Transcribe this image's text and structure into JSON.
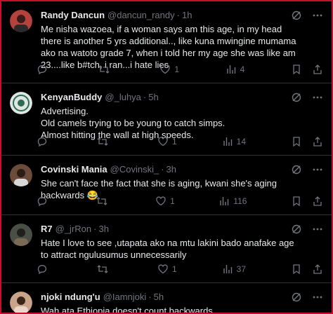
{
  "tweets": [
    {
      "name": "Randy Dancun",
      "handle": "@dancun_randy",
      "time": "1h",
      "text": "Me nisha wazoea, if a woman says am this age, in my head there is another 5 yrs additional.., like kuna mwingine mumama ako na watoto grade 7, when i told her my age she was like am 23....like b#tch, i ran...i hate lies",
      "reply_count": "",
      "retweet_count": "",
      "like_count": "1",
      "view_count": "4",
      "avatar_color": "#b5423d"
    },
    {
      "name": "KenyanBuddy",
      "handle": "@_luhya",
      "time": "5h",
      "text": "Advertising.\nOld camels trying to be young to catch simps.\nAlmost hitting the wall at high speeds.",
      "reply_count": "",
      "retweet_count": "",
      "like_count": "1",
      "view_count": "14",
      "avatar_color": "#dfe6e3"
    },
    {
      "name": "Covinski Mania",
      "handle": "@Covinski_",
      "time": "3h",
      "text": "She can't face the fact that she is aging, kwani she's aging backwards 😂",
      "reply_count": "",
      "retweet_count": "",
      "like_count": "1",
      "view_count": "116",
      "avatar_color": "#6b4b3a"
    },
    {
      "name": "R7",
      "handle": "@_jrRon",
      "time": "3h",
      "text": "Hate I love to see ,utapata ako na mtu lakini bado anafake age to attract ngulusumus unnecessarily",
      "reply_count": "",
      "retweet_count": "",
      "like_count": "1",
      "view_count": "37",
      "avatar_color": "#4a4f46"
    },
    {
      "name": "njoki ndung'u",
      "handle": "@Iamnjoki",
      "time": "5h",
      "text": "Wah ata Ethiopia doesn't count backwards",
      "avatar_color": "#c9a48b"
    }
  ]
}
